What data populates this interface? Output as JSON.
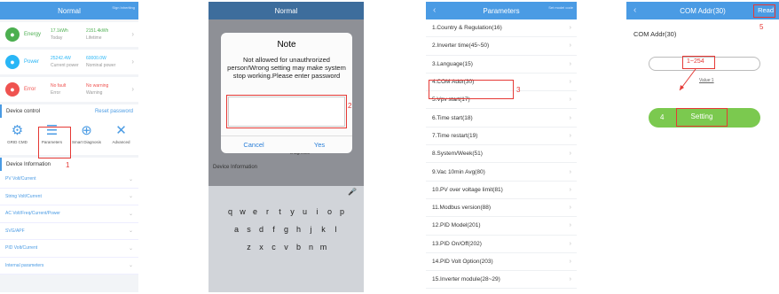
{
  "phone1": {
    "title": "Normal",
    "header_right": "Sign Inheriting",
    "stats": [
      {
        "label": "Energy",
        "v1": "17.1kWh",
        "c1": "Today",
        "v2": "2151.4kWh",
        "c2": "Lifetime",
        "color": "#4caf50",
        "icon": "energy-icon"
      },
      {
        "label": "Power",
        "v1": "25242.4W",
        "c1": "Current power",
        "v2": "60000.0W",
        "c2": "Nominal power",
        "color": "#29b6f6",
        "icon": "power-icon"
      },
      {
        "label": "Error",
        "v1": "No fault",
        "c1": "Error",
        "v2": "No warning",
        "c2": "Warning",
        "color": "#ef5350",
        "icon": "error-icon"
      }
    ],
    "device_control": "Device control",
    "reset_password": "Reset password",
    "controls": [
      "GRID CMD",
      "Parameters",
      "Smart Diagnosis",
      "Advanced"
    ],
    "device_information": "Device Information",
    "info_rows": [
      "PV Volt/Current",
      "String Volt/Current",
      "AC Volt/Freq/Current/Power",
      "SVG/APF",
      "PID Volt/Current",
      "Internal parameters"
    ],
    "step": "1"
  },
  "phone2": {
    "title": "Normal",
    "dialog_title": "Note",
    "dialog_message": "Not allowed for unauthrorized person!Wrong setting may make system stop working.Please enter password",
    "cancel": "Cancel",
    "yes": "Yes",
    "bg_label": "Device Information",
    "bg_diag": "Diagnosis",
    "step": "2",
    "kb_row1": [
      "q",
      "w",
      "e",
      "r",
      "t",
      "y",
      "u",
      "i",
      "o",
      "p"
    ],
    "kb_row2": [
      "a",
      "s",
      "d",
      "f",
      "g",
      "h",
      "j",
      "k",
      "l"
    ],
    "kb_row3": [
      "z",
      "x",
      "c",
      "v",
      "b",
      "n",
      "m"
    ]
  },
  "phone3": {
    "title": "Parameters",
    "header_right": "Set model code",
    "items": [
      "1.Country & Regulation(16)",
      "2.Inverter time(45~50)",
      "3.Language(15)",
      "4.COM Addr(30)",
      "5.Vpv start(17)",
      "6.Time start(18)",
      "7.Time restart(19)",
      "8.System/Week(51)",
      "9.Vac 10min Avg(80)",
      "10.PV over voltage limit(81)",
      "11.Modbus version(88)",
      "12.PID Model(201)",
      "13.PID On/Off(202)",
      "14.PID Volt Option(203)",
      "15.Inverter module(28~29)"
    ],
    "step": "3"
  },
  "phone4": {
    "title": "COM Addr(30)",
    "read": "Read",
    "label": "COM Addr(30)",
    "range": "1~254",
    "value_hint": "Value:1",
    "setting": "Setting",
    "step_setting": "4",
    "step_read": "5"
  }
}
